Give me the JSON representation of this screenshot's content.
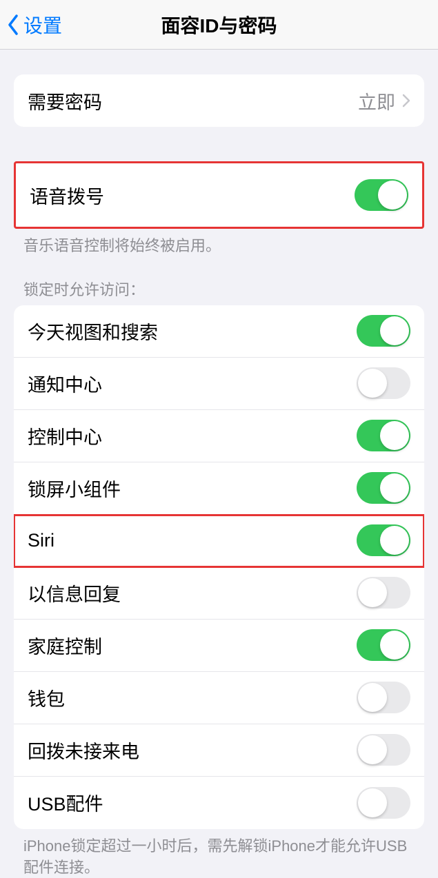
{
  "nav": {
    "back_label": "设置",
    "title": "面容ID与密码"
  },
  "require_passcode": {
    "label": "需要密码",
    "value": "立即"
  },
  "voice_dial": {
    "label": "语音拨号",
    "on": true,
    "footer": "音乐语音控制将始终被启用。"
  },
  "locked_access": {
    "header": "锁定时允许访问：",
    "items": [
      {
        "label": "今天视图和搜索",
        "on": true
      },
      {
        "label": "通知中心",
        "on": false
      },
      {
        "label": "控制中心",
        "on": true
      },
      {
        "label": "锁屏小组件",
        "on": true
      },
      {
        "label": "Siri",
        "on": true
      },
      {
        "label": "以信息回复",
        "on": false
      },
      {
        "label": "家庭控制",
        "on": true
      },
      {
        "label": "钱包",
        "on": false
      },
      {
        "label": "回拨未接来电",
        "on": false
      },
      {
        "label": "USB配件",
        "on": false
      }
    ],
    "footer": "iPhone锁定超过一小时后，需先解锁iPhone才能允许USB配件连接。"
  }
}
